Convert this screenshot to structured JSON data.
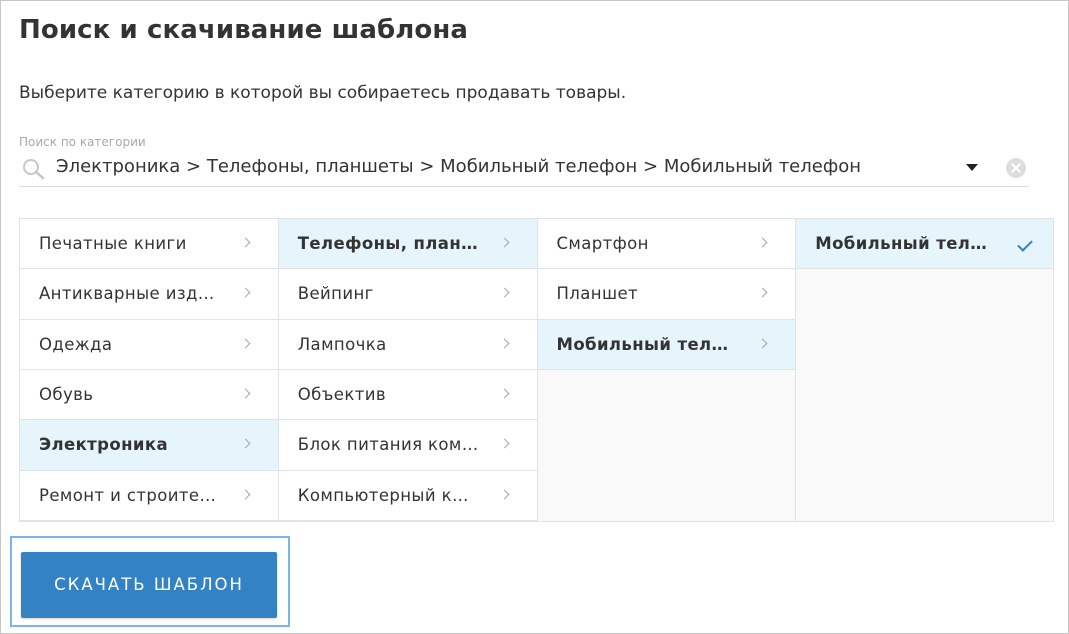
{
  "page": {
    "title": "Поиск и скачивание шаблона",
    "subtitle": "Выберите категорию в которой вы собираетесь продавать товары."
  },
  "search": {
    "label": "Поиск по категории",
    "value": "Электроника > Телефоны, планшеты > Мобильный телефон > Мобильный телефон"
  },
  "columns": [
    {
      "items": [
        {
          "label": "Печатные книги",
          "selected": false
        },
        {
          "label": "Антикварные изд…",
          "selected": false
        },
        {
          "label": "Одежда",
          "selected": false
        },
        {
          "label": "Обувь",
          "selected": false
        },
        {
          "label": "Электроника",
          "selected": true
        },
        {
          "label": "Ремонт и строите…",
          "selected": false
        }
      ]
    },
    {
      "items": [
        {
          "label": "Телефоны, план…",
          "selected": true
        },
        {
          "label": "Вейпинг",
          "selected": false
        },
        {
          "label": "Лампочка",
          "selected": false
        },
        {
          "label": "Объектив",
          "selected": false
        },
        {
          "label": "Блок питания ком…",
          "selected": false
        },
        {
          "label": "Компьютерный к…",
          "selected": false
        }
      ]
    },
    {
      "items": [
        {
          "label": "Смартфон",
          "selected": false
        },
        {
          "label": "Планшет",
          "selected": false
        },
        {
          "label": "Мобильный тел…",
          "selected": true
        }
      ]
    },
    {
      "items": [
        {
          "label": "Мобильный тел…",
          "selected": true,
          "final": true
        }
      ]
    }
  ],
  "actions": {
    "download_label": "СКАЧАТЬ ШАБЛОН"
  },
  "colors": {
    "accent": "#3382c4",
    "selected_row": "#e6f4fc",
    "focus_outline": "#7bb6e8"
  }
}
